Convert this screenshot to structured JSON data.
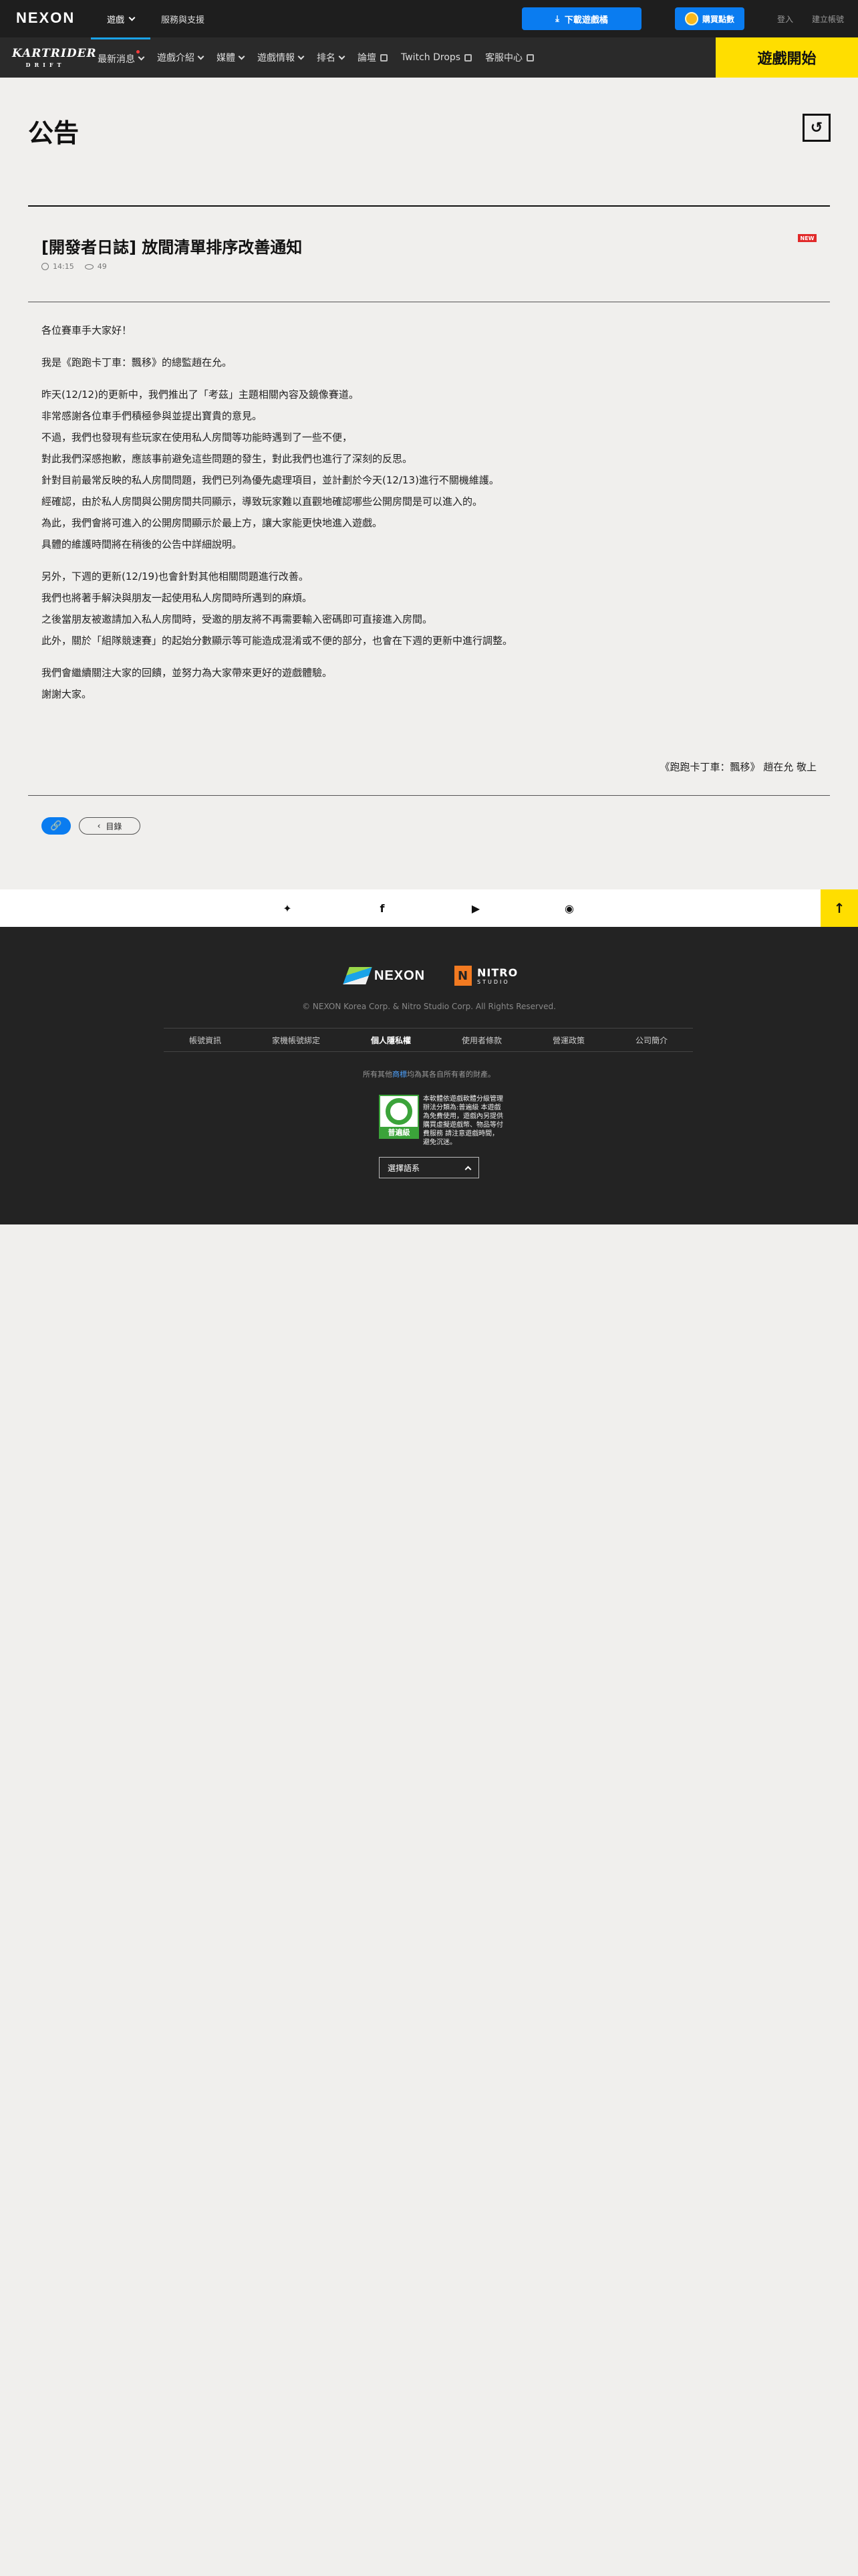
{
  "global_bar": {
    "logo": "NEXON",
    "menu": [
      "遊戲",
      "服務與支援"
    ],
    "download_label": "下載遊戲橘",
    "points_label": "購買點數",
    "login_label": "登入",
    "register_label": "建立帳號"
  },
  "game_nav": {
    "logo_text": "KARTRIDER",
    "logo_sub": "DRIFT",
    "items": [
      "最新消息",
      "遊戲介紹",
      "媒體",
      "遊戲情報",
      "排名",
      "論壇",
      "Twitch Drops",
      "客服中心"
    ],
    "play_label": "遊戲開始"
  },
  "page": {
    "title": "公告",
    "back_icon": "↺"
  },
  "post": {
    "title": "[開發者日誌] 放間清單排序改善通知",
    "badge": "NEW",
    "time": "14:15",
    "views": "49",
    "paragraphs": [
      [
        "各位賽車手大家好！"
      ],
      [
        "我是《跑跑卡丁車：飄移》的總監趙在允。"
      ],
      [
        "昨天(12/12)的更新中，我們推出了「考茲」主題相關內容及鏡像賽道。",
        "非常感謝各位車手們積極參與並提出寶貴的意見。",
        "不過，我們也發現有些玩家在使用私人房間等功能時遇到了一些不便，",
        "對此我們深感抱歉，應該事前避免這些問題的發生，對此我們也進行了深刻的反思。",
        "針對目前最常反映的私人房間問題，我們已列為優先處理項目，並計劃於今天(12/13)進行不關機維護。",
        "經確認，由於私人房間與公開房間共同顯示，導致玩家難以直觀地確認哪些公開房間是可以進入的。",
        "為此，我們會將可進入的公開房間顯示於最上方，讓大家能更快地進入遊戲。",
        "具體的維護時間將在稍後的公告中詳細說明。"
      ],
      [
        "另外，下週的更新(12/19)也會針對其他相關問題進行改善。",
        "我們也將著手解決與朋友一起使用私人房間時所遇到的麻煩。",
        "之後當朋友被邀請加入私人房間時，受邀的朋友將不再需要輸入密碼即可直接進入房間。",
        "此外，關於「組隊競速賽」的起始分數顯示等可能造成混淆或不便的部分，也會在下週的更新中進行調整。"
      ],
      [
        "我們會繼續關注大家的回饋，並努力為大家帶來更好的遊戲體驗。",
        "謝謝大家。"
      ]
    ],
    "signature": "《跑跑卡丁車：飄移》 趙在允 敬上",
    "list_label": "目錄"
  },
  "social": {
    "icons": [
      "kartrider-icon",
      "facebook-icon",
      "youtube-icon",
      "discord-icon"
    ],
    "facebook_glyph": "f",
    "youtube_glyph": "▶",
    "discord_glyph": "◉",
    "kart_glyph": "✦",
    "top_glyph": "↑"
  },
  "footer": {
    "nexon": "NEXON",
    "nitro": "NITRO",
    "nitro_sub": "STUDIO",
    "copyright": "© NEXON Korea Corp. & Nitro Studio Corp. All Rights Reserved.",
    "links": [
      "帳號資訊",
      "家機帳號綁定",
      "個人隱私權",
      "使用者條款",
      "營運政策",
      "公司簡介"
    ],
    "trademark_pre": "所有其他",
    "trademark_link": "商標",
    "trademark_post": "均為其各自所有者的財產。",
    "rating_label": "普遍級",
    "rating_text": "本軟體依遊戲軟體分級管理辦法分類為:普遍級 本遊戲為免費使用，遊戲內另提供購買虛擬遊戲幣、物品等付費服務 請注意遊戲時間，避免沉迷。",
    "lang_label": "選擇語系"
  }
}
